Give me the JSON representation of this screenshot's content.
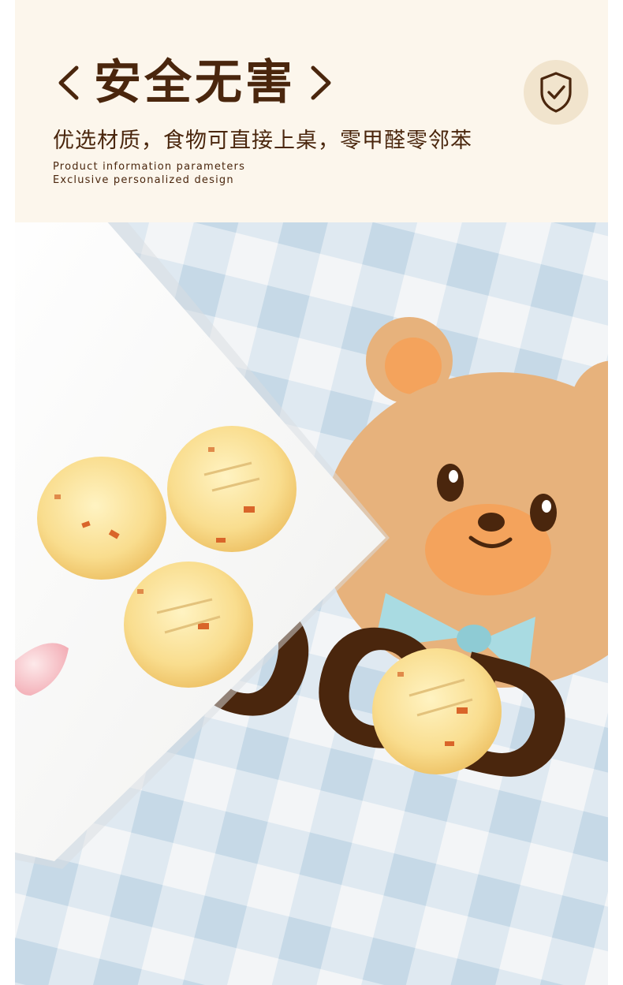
{
  "header": {
    "title": "安全无害",
    "left_chevron_icon": "chevron-left-icon",
    "right_chevron_icon": "chevron-right-icon",
    "subtitle": "优选材质，食物可直接上桌，零甲醛零邻苯",
    "english_line_1": "Product information parameters",
    "english_line_2": "Exclusive personalized design",
    "badge_icon": "shield-check-icon"
  },
  "photo": {
    "mat_lettering": "OOD LU"
  },
  "colors": {
    "header_bg": "#fcf6ec",
    "brand_brown": "#4a260d",
    "badge_bg": "#f1e4cd",
    "gingham_blue": "#c8dbe8",
    "bear_tan": "#e7b27c"
  }
}
